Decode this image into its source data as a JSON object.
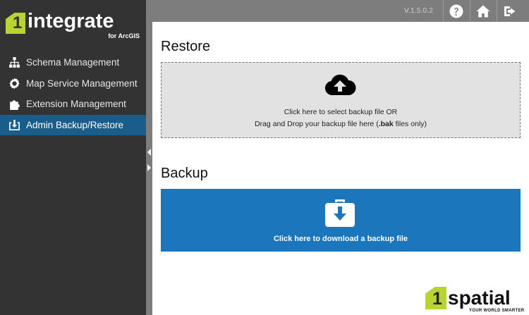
{
  "sidebar": {
    "logo": {
      "word": "integrate",
      "one": "1",
      "sub": "for ArcGIS"
    },
    "items": [
      {
        "label": "Schema Management",
        "icon": "sitemap-icon"
      },
      {
        "label": "Map Service Management",
        "icon": "gears-icon"
      },
      {
        "label": "Extension Management",
        "icon": "puzzle-icon"
      },
      {
        "label": "Admin Backup/Restore",
        "icon": "download-box-icon",
        "active": true
      }
    ]
  },
  "topbar": {
    "version": "V.1.5.0.2",
    "buttons": [
      "help-icon",
      "home-icon",
      "logout-icon"
    ]
  },
  "restore": {
    "title": "Restore",
    "line1": "Click here to select backup file OR",
    "line2_prefix": "Drag and Drop your backup file here (",
    "line2_bold": ".bak",
    "line2_suffix": " files only)",
    "icon": "cloud-upload-icon"
  },
  "backup": {
    "title": "Backup",
    "label": "Click here to download a backup file",
    "icon": "briefcase-download-icon"
  },
  "footer": {
    "one": "1",
    "word": "spatial",
    "tagline": "YOUR WORLD SMARTER"
  },
  "colors": {
    "sidebar_bg": "#333333",
    "active_item": "#1a5c8a",
    "topbar_bg": "#7d7d7d",
    "backup_button": "#1b76bb",
    "brand_green": "#b8d430"
  }
}
